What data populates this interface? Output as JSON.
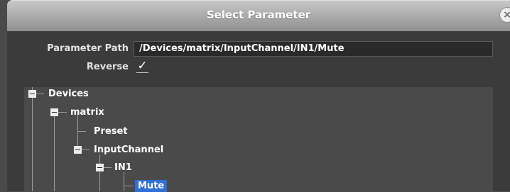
{
  "window": {
    "title": "Select Parameter",
    "close_icon": "close-icon"
  },
  "form": {
    "path_label": "Parameter Path",
    "path_value": "/Devices/matrix/InputChannel/IN1/Mute",
    "reverse_label": "Reverse",
    "reverse_checked": true,
    "check_glyph": "✓"
  },
  "tree": {
    "devices": "Devices",
    "matrix": "matrix",
    "preset": "Preset",
    "inputchannel": "InputChannel",
    "in1": "IN1",
    "mute": "Mute",
    "selected": "Mute"
  },
  "colors": {
    "selection": "#2f6fd6",
    "panel": "#3b3b3b"
  }
}
